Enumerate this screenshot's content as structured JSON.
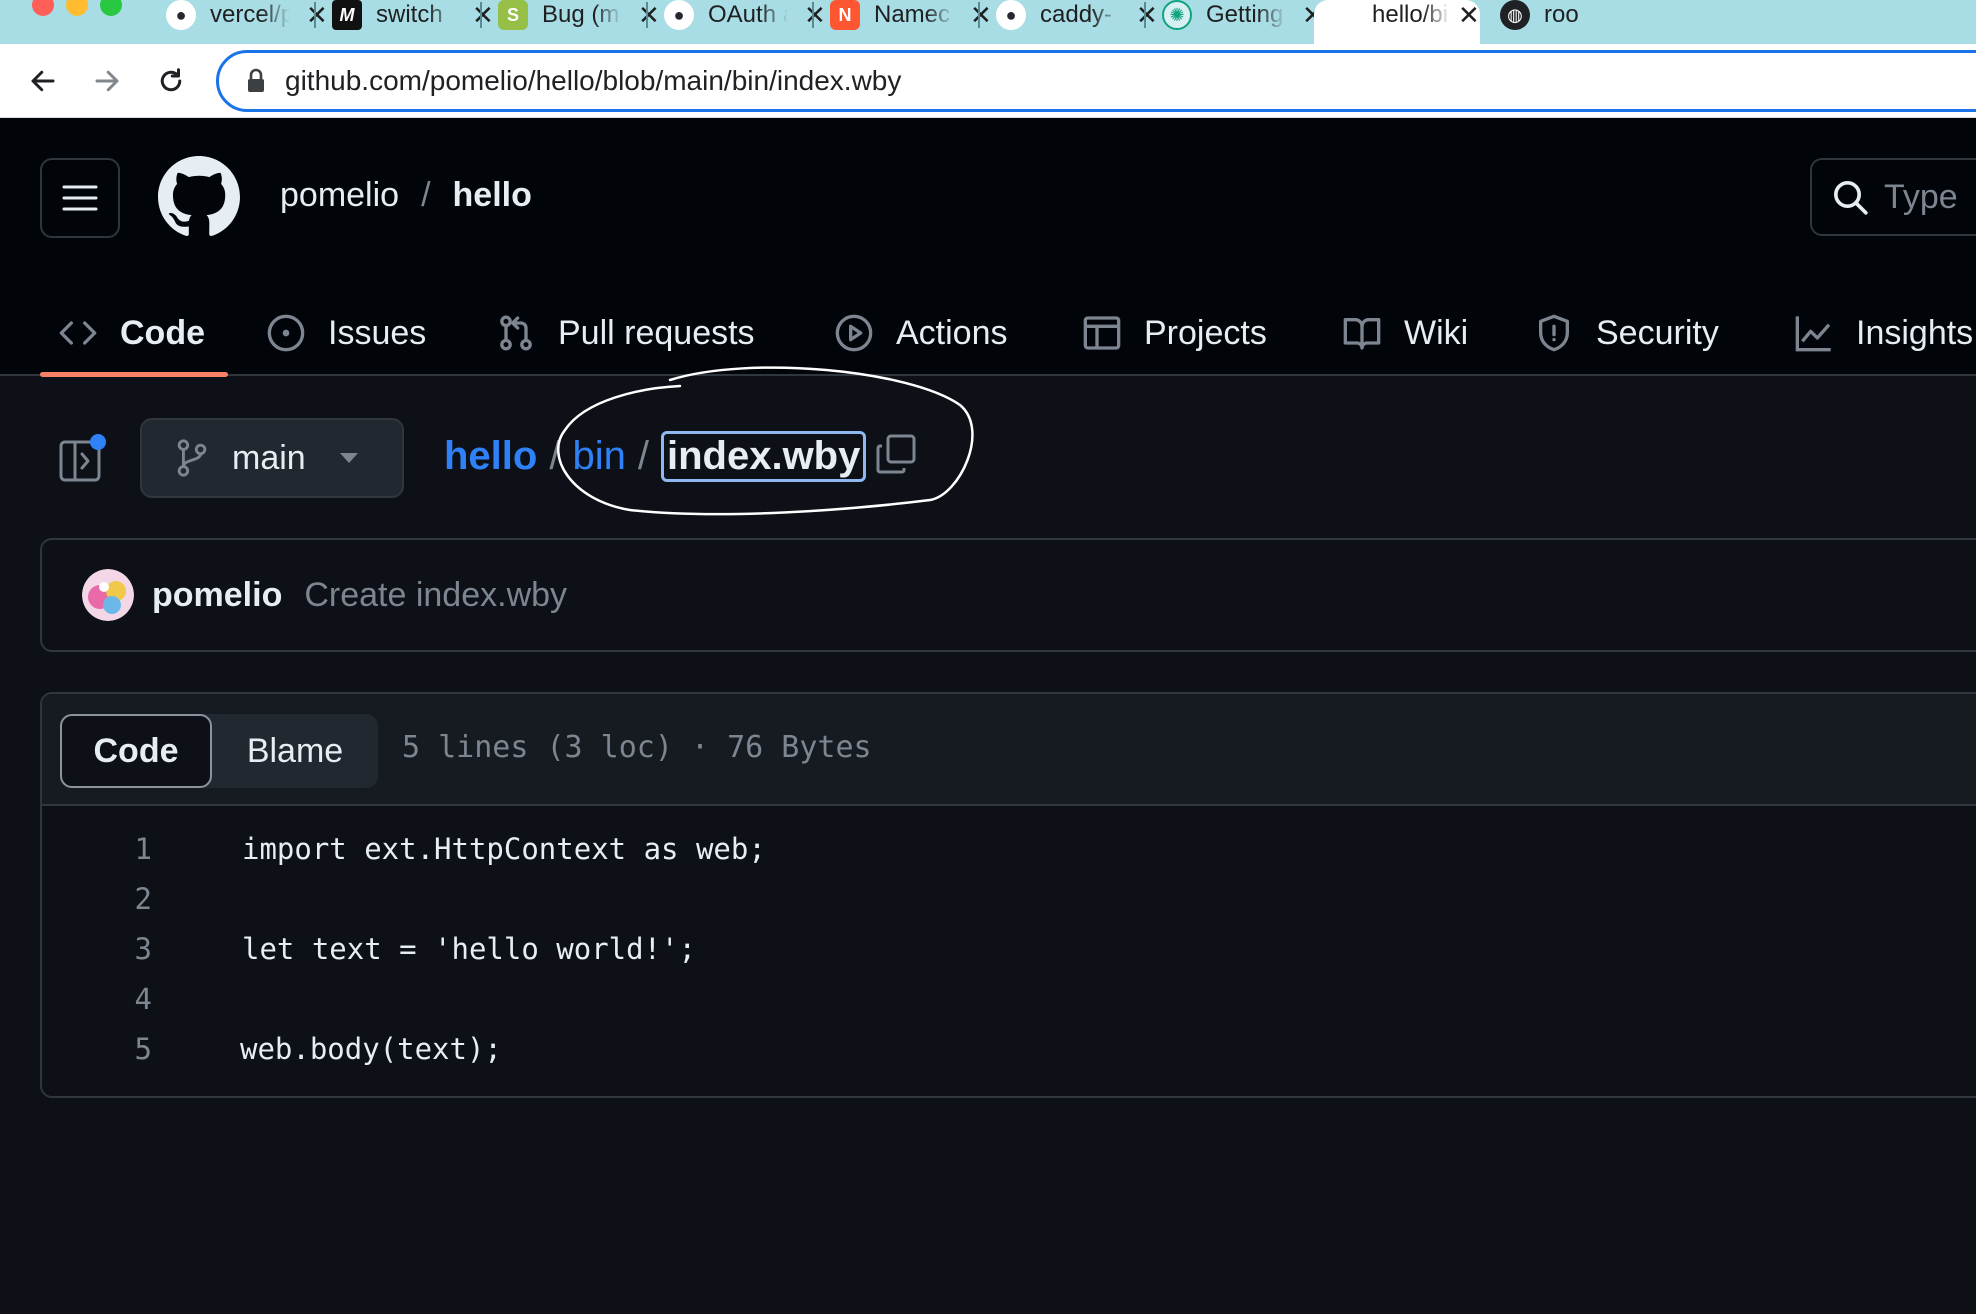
{
  "browser": {
    "tabs": [
      {
        "title": "vercel/p",
        "icon": "github-icon"
      },
      {
        "title": "switch",
        "icon": "m-logo-icon"
      },
      {
        "title": "Bug (m",
        "icon": "shopify-icon"
      },
      {
        "title": "OAuth a",
        "icon": "github-icon"
      },
      {
        "title": "Namec",
        "icon": "namecheap-icon"
      },
      {
        "title": "caddy-",
        "icon": "github-icon"
      },
      {
        "title": "Getting",
        "icon": "openai-icon"
      },
      {
        "title": "hello/bi",
        "icon": "github-icon"
      },
      {
        "title": "roo",
        "icon": "globe-icon"
      }
    ],
    "url": "github.com/pomelio/hello/blob/main/bin/index.wby"
  },
  "header": {
    "owner": "pomelio",
    "separator": "/",
    "repo": "hello",
    "search_placeholder": "Type"
  },
  "repo_tabs": [
    {
      "label": "Code",
      "icon": "code-icon"
    },
    {
      "label": "Issues",
      "icon": "issue-icon"
    },
    {
      "label": "Pull requests",
      "icon": "pull-request-icon"
    },
    {
      "label": "Actions",
      "icon": "play-icon"
    },
    {
      "label": "Projects",
      "icon": "table-icon"
    },
    {
      "label": "Wiki",
      "icon": "book-icon"
    },
    {
      "label": "Security",
      "icon": "shield-icon"
    },
    {
      "label": "Insights",
      "icon": "graph-icon"
    }
  ],
  "file_nav": {
    "branch": "main",
    "breadcrumb": {
      "repo": "hello",
      "dir": "bin",
      "file": "index.wby",
      "sep": "/"
    }
  },
  "commit": {
    "author": "pomelio",
    "message": "Create index.wby"
  },
  "code_view": {
    "tab_code": "Code",
    "tab_blame": "Blame",
    "meta": "5 lines (3 loc) · 76 Bytes",
    "lines": [
      {
        "n": "1",
        "text": "import ext.HttpContext as web;"
      },
      {
        "n": "2",
        "text": ""
      },
      {
        "n": "3",
        "text": "let text = 'hello world!';"
      },
      {
        "n": "4",
        "text": ""
      },
      {
        "n": "5",
        "text": "web.body(text);"
      }
    ]
  },
  "colors": {
    "accent_link": "#2f81f7",
    "tab_underline": "#f78166",
    "background": "#0d1117",
    "header_bg": "#010409"
  }
}
